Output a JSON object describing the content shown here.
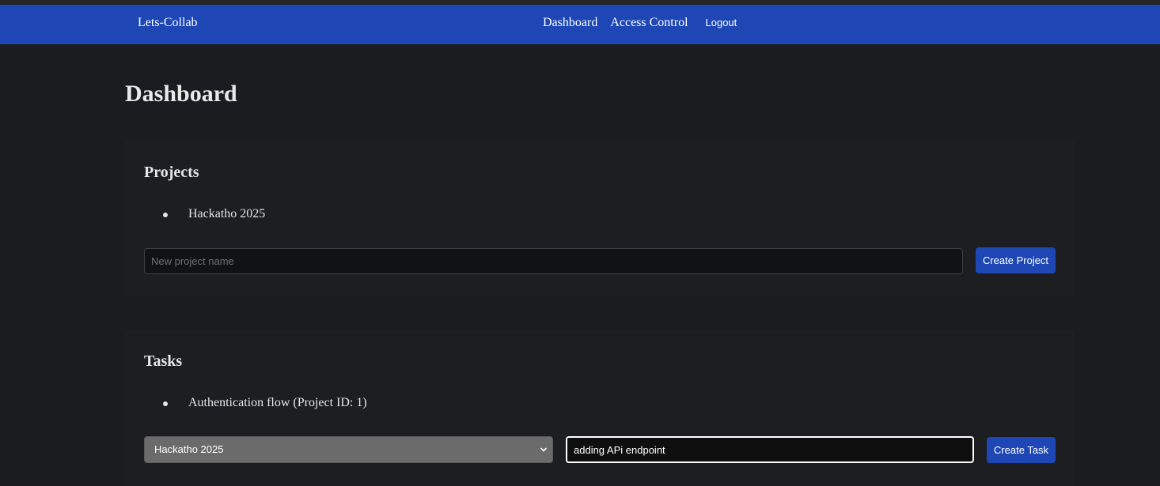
{
  "nav": {
    "brand": "Lets-Collab",
    "links": [
      "Dashboard",
      "Access Control"
    ],
    "logout_label": "Logout"
  },
  "page": {
    "title": "Dashboard"
  },
  "projects": {
    "heading": "Projects",
    "items": [
      "Hackatho 2025"
    ],
    "new_project_placeholder": "New project name",
    "new_project_value": "",
    "create_label": "Create Project"
  },
  "tasks": {
    "heading": "Tasks",
    "items": [
      "Authentication flow (Project ID: 1)"
    ],
    "project_select_value": "Hackatho 2025",
    "task_input_value": "adding APi endpoint",
    "create_label": "Create Task"
  },
  "colors": {
    "background": "#1b1c1f",
    "navbar": "#1e47b5",
    "primary_button": "#1e47b5",
    "select_background": "#6b6b6b"
  },
  "icons": {
    "select_arrow": "chevron-down-icon"
  }
}
